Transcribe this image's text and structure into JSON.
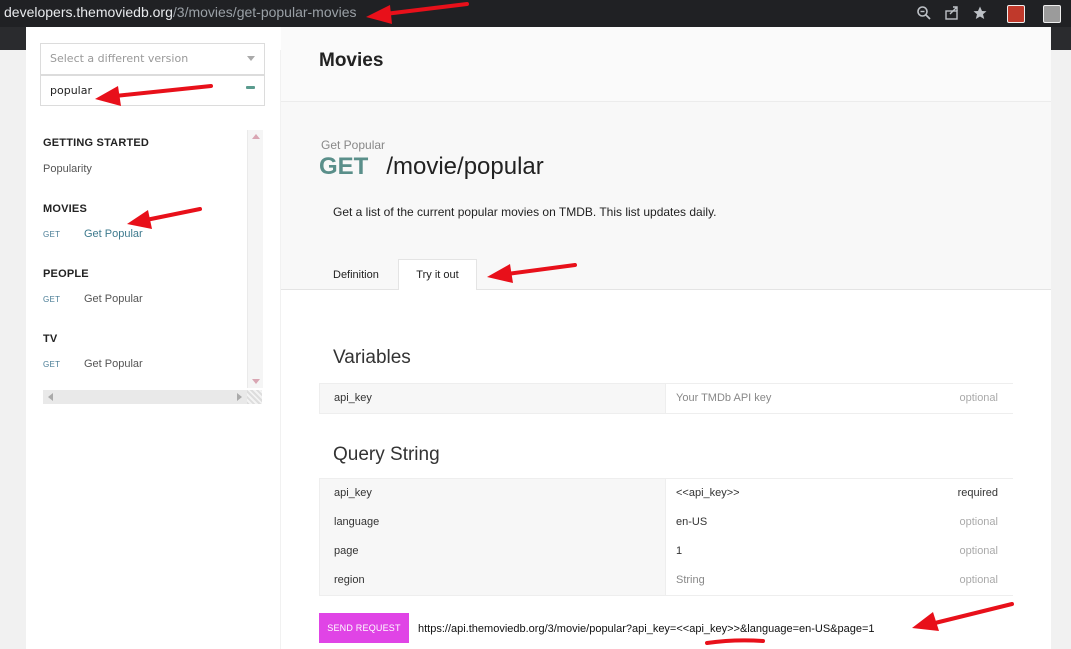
{
  "browser": {
    "url_host": "developers.themoviedb.org",
    "url_path": "/3/movies/get-popular-movies"
  },
  "sidebar": {
    "version_placeholder": "Select a different version",
    "search_value": "popular",
    "sections": [
      {
        "title": "GETTING STARTED",
        "items": [
          {
            "method": "",
            "label": "Popularity"
          }
        ]
      },
      {
        "title": "MOVIES",
        "items": [
          {
            "method": "GET",
            "label": "Get Popular"
          }
        ]
      },
      {
        "title": "PEOPLE",
        "items": [
          {
            "method": "GET",
            "label": "Get Popular"
          }
        ]
      },
      {
        "title": "TV",
        "items": [
          {
            "method": "GET",
            "label": "Get Popular"
          }
        ]
      }
    ]
  },
  "main": {
    "title": "Movies",
    "endpoint_subtitle": "Get Popular",
    "method": "GET",
    "path": "/movie/popular",
    "description": "Get a list of the current popular movies on TMDB. This list updates daily.",
    "tabs": [
      "Definition",
      "Try it out"
    ],
    "variables_title": "Variables",
    "variables": [
      {
        "name": "api_key",
        "value": "Your TMDb API key",
        "status": "optional"
      }
    ],
    "query_title": "Query String",
    "query": [
      {
        "name": "api_key",
        "value": "<<api_key>>",
        "status": "required"
      },
      {
        "name": "language",
        "value": "en-US",
        "status": "optional"
      },
      {
        "name": "page",
        "value": "1",
        "status": "optional"
      },
      {
        "name": "region",
        "value": "String",
        "status": "optional"
      }
    ],
    "send_label": "SEND REQUEST",
    "request_url": "https://api.themoviedb.org/3/movie/popular?api_key=<<api_key>>&language=en-US&page=1"
  },
  "colors": {
    "annotation_arrow": "#e8101a",
    "send_button": "#e044e6",
    "method_get": "#5a8f8a"
  }
}
